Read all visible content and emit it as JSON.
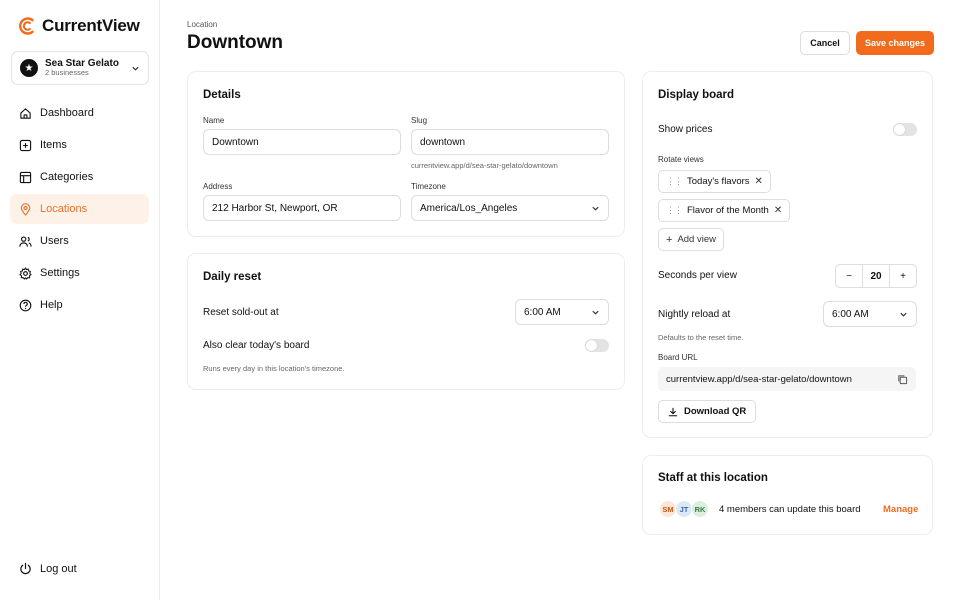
{
  "brand": {
    "name": "CurrentView",
    "accent": "#f26b1d"
  },
  "business": {
    "name": "Sea Star Gelato",
    "sub": "2 businesses"
  },
  "nav": [
    {
      "label": "Dashboard",
      "icon": "home-icon"
    },
    {
      "label": "Items",
      "icon": "plus-square-icon"
    },
    {
      "label": "Categories",
      "icon": "layout-icon"
    },
    {
      "label": "Locations",
      "icon": "map-pin-icon",
      "active": true
    },
    {
      "label": "Users",
      "icon": "users-icon"
    },
    {
      "label": "Settings",
      "icon": "gear-icon"
    },
    {
      "label": "Help",
      "icon": "help-icon"
    }
  ],
  "logout": "Log out",
  "header": {
    "breadcrumb": "Location",
    "title": "Downtown",
    "cancel": "Cancel",
    "save": "Save changes"
  },
  "details": {
    "title": "Details",
    "name_label": "Name",
    "name_value": "Downtown",
    "slug_label": "Slug",
    "slug_value": "downtown",
    "slug_hint": "currentview.app/d/sea-star-gelato/downtown",
    "address_label": "Address",
    "address_value": "212 Harbor St, Newport, OR",
    "timezone_label": "Timezone",
    "timezone_value": "America/Los_Angeles"
  },
  "daily_reset": {
    "title": "Daily reset",
    "soldout_label": "Reset sold-out at",
    "soldout_value": "6:00 AM",
    "clear_label": "Also clear today's board",
    "clear_on": false,
    "hint": "Runs every day in this location's timezone."
  },
  "display_board": {
    "title": "Display board",
    "show_prices_label": "Show prices",
    "show_prices_on": false,
    "rotate_label": "Rotate views",
    "views": [
      "Today's flavors",
      "Flavor of the Month"
    ],
    "add_view": "Add view",
    "seconds_label": "Seconds per view",
    "seconds_value": "20",
    "minus": "−",
    "plus": "+",
    "reload_label": "Nightly reload at",
    "reload_value": "6:00 AM",
    "reload_hint": "Defaults to the reset time.",
    "url_label": "Board URL",
    "url_value": "currentview.app/d/sea-star-gelato/downtown",
    "download": "Download QR"
  },
  "staff": {
    "title": "Staff at this location",
    "avatars": [
      {
        "initials": "SM",
        "bg": "#fde6d6",
        "fg": "#c2581a"
      },
      {
        "initials": "JT",
        "bg": "#dde8f7",
        "fg": "#3b64a8"
      },
      {
        "initials": "RK",
        "bg": "#dcefdf",
        "fg": "#3a7d45"
      }
    ],
    "members_text": "4 members can update this board",
    "manage": "Manage"
  }
}
